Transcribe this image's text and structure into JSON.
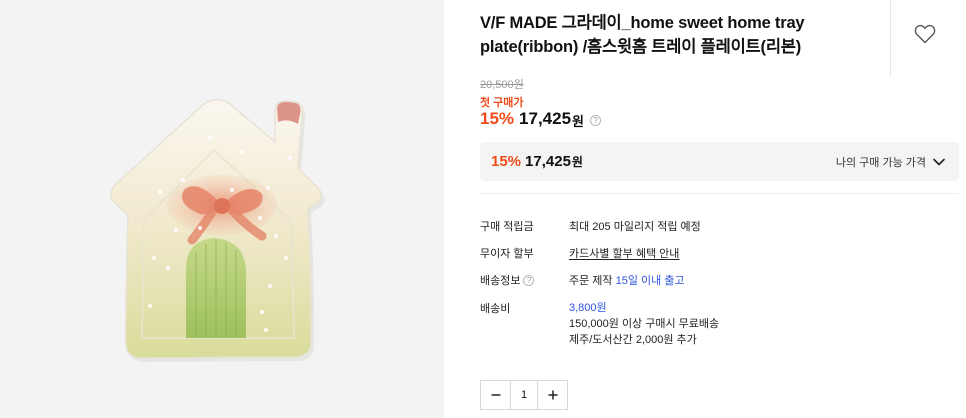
{
  "product": {
    "title": "V/F MADE 그라데이_home sweet home tray plate(ribbon) /홈스윗홈 트레이 플레이트(리본)",
    "original_price": "20,500원",
    "first_purchase_label": "첫 구매가",
    "discount_pct": "15%",
    "price": "17,425",
    "currency": "원",
    "help_symbol": "?"
  },
  "my_price": {
    "discount_pct": "15%",
    "price": "17,425",
    "currency": "원",
    "toggle_label": "나의 구매 가능 가격"
  },
  "details": {
    "points_label": "구매 적립금",
    "points_value": "최대 205 마일리지 적립 예정",
    "installment_label": "무이자 할부",
    "installment_value": "카드사별 할부 혜택 안내",
    "shipping_info_label": "배송정보",
    "shipping_info_prefix": "주문 제작",
    "shipping_info_highlight": "15일 이내 출고",
    "shipping_fee_label": "배송비",
    "shipping_fee_value": "3,800원",
    "shipping_fee_note1": "150,000원 이상 구매시 무료배송",
    "shipping_fee_note2": "제주/도서산간 2,000원 추가"
  },
  "quantity": {
    "value": "1"
  },
  "icons": {
    "wishlist": "heart-outline-icon",
    "dropdown": "chevron-down-icon",
    "help": "question-circle-icon",
    "decrease": "minus-icon",
    "increase": "plus-icon"
  },
  "colors": {
    "accent_orange": "#ef4b1a",
    "link_blue": "#2d55e0",
    "panel_gray": "#f4f4f4"
  }
}
